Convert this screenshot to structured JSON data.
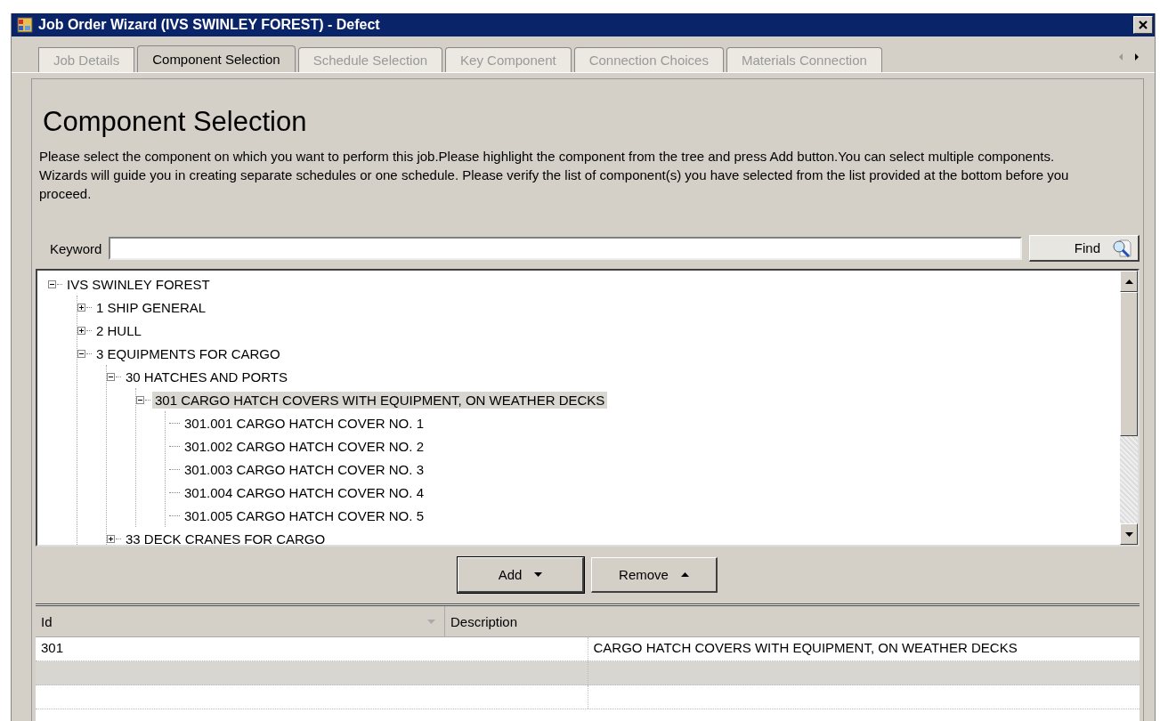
{
  "window": {
    "title": "Job Order Wizard (IVS SWINLEY FOREST) - Defect"
  },
  "tabs": [
    {
      "label": "Job Details",
      "selected": false
    },
    {
      "label": "Component Selection",
      "selected": true
    },
    {
      "label": "Schedule Selection",
      "selected": false
    },
    {
      "label": "Key Component",
      "selected": false
    },
    {
      "label": "Connection Choices",
      "selected": false
    },
    {
      "label": "Materials Connection",
      "selected": false
    }
  ],
  "page": {
    "heading": "Component Selection",
    "description": "Please select the component on which you want to perform this job.Please highlight the component from the tree and press Add button.You can select multiple components. Wizards will guide you in creating separate schedules or one schedule.  Please verify the list of component(s) you have selected from the list provided at the bottom before you proceed."
  },
  "search": {
    "label": "Keyword",
    "button": "Find"
  },
  "tree": [
    {
      "label": "IVS SWINLEY FOREST",
      "expanded": true,
      "selected": false,
      "children": [
        {
          "label": "1  SHIP GENERAL",
          "expanded": false,
          "selected": false
        },
        {
          "label": "2  HULL",
          "expanded": false,
          "selected": false
        },
        {
          "label": "3  EQUIPMENTS FOR CARGO",
          "expanded": true,
          "selected": false,
          "children": [
            {
              "label": "30  HATCHES AND PORTS",
              "expanded": true,
              "selected": false,
              "children": [
                {
                  "label": "301  CARGO HATCH COVERS WITH EQUIPMENT, ON WEATHER DECKS",
                  "expanded": true,
                  "selected": true,
                  "children": [
                    {
                      "label": "301.001  CARGO HATCH COVER NO. 1",
                      "selected": false
                    },
                    {
                      "label": "301.002  CARGO HATCH COVER NO. 2",
                      "selected": false
                    },
                    {
                      "label": "301.003  CARGO HATCH COVER NO. 3",
                      "selected": false
                    },
                    {
                      "label": "301.004  CARGO HATCH COVER NO. 4",
                      "selected": false
                    },
                    {
                      "label": "301.005  CARGO HATCH COVER NO. 5",
                      "selected": false
                    }
                  ]
                }
              ]
            },
            {
              "label": "33  DECK CRANES FOR CARGO",
              "expanded": false,
              "selected": false
            }
          ]
        }
      ]
    }
  ],
  "actions": [
    {
      "label": "Add",
      "kind": "dropdown-down"
    },
    {
      "label": "Remove",
      "kind": "dropdown-up"
    }
  ],
  "grid": {
    "columns": [
      "Id",
      "Description"
    ],
    "rows": [
      [
        "301",
        "CARGO HATCH COVERS WITH EQUIPMENT, ON WEATHER DECKS"
      ]
    ]
  }
}
